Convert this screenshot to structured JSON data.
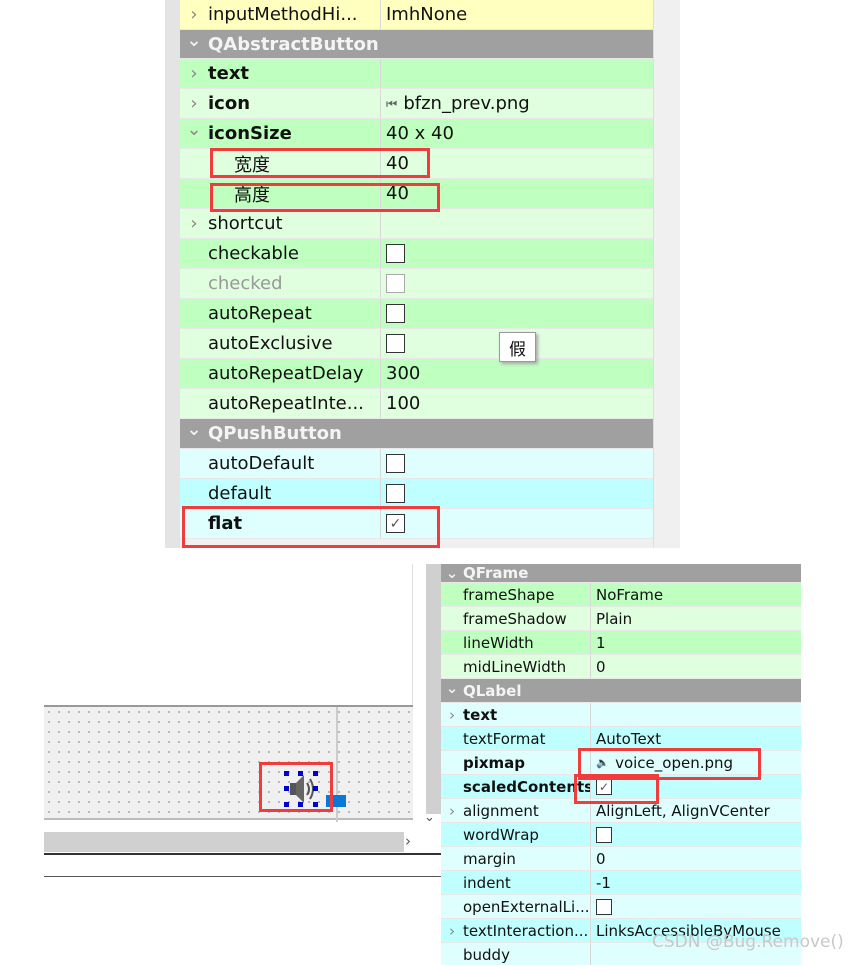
{
  "top_panel": {
    "rows": [
      {
        "label": "inputMethodHi...",
        "value": "ImhNone",
        "bg": "#ffffc0",
        "expand": "right"
      },
      {
        "label": "QAbstractButton",
        "header": true
      },
      {
        "label": "text",
        "value": "",
        "bg": "#bfffbf",
        "bold": true,
        "expand": "right"
      },
      {
        "label": "icon",
        "value": "bfzn_prev.png",
        "icon": "prev-icon",
        "bg": "#dfffdf",
        "bold": true,
        "expand": "right"
      },
      {
        "label": "iconSize",
        "value": "40 x 40",
        "bg": "#bfffbf",
        "bold": true,
        "expand": "down"
      },
      {
        "label": "宽度",
        "value": "40",
        "bg": "#dfffdf",
        "indent": true
      },
      {
        "label": "高度",
        "value": "40",
        "bg": "#bfffbf",
        "indent": true
      },
      {
        "label": "shortcut",
        "value": "",
        "bg": "#dfffdf",
        "expand": "right"
      },
      {
        "label": "checkable",
        "checkbox": false,
        "bg": "#bfffbf"
      },
      {
        "label": "checked",
        "checkbox": false,
        "disabled": true,
        "bg": "#dfffdf"
      },
      {
        "label": "autoRepeat",
        "checkbox": false,
        "bg": "#bfffbf"
      },
      {
        "label": "autoExclusive",
        "checkbox": false,
        "bg": "#dfffdf"
      },
      {
        "label": "autoRepeatDelay",
        "value": "300",
        "bg": "#bfffbf"
      },
      {
        "label": "autoRepeatInte...",
        "value": "100",
        "bg": "#dfffdf"
      },
      {
        "label": "QPushButton",
        "header": true
      },
      {
        "label": "autoDefault",
        "checkbox": false,
        "bg": "#dfffff"
      },
      {
        "label": "default",
        "checkbox": false,
        "bg": "#bfffff"
      },
      {
        "label": "flat",
        "checkbox": true,
        "bold": true,
        "bg": "#dfffff"
      }
    ],
    "tooltip": "假"
  },
  "bottom_panel": {
    "rows": [
      {
        "label": "QFrame",
        "header": true
      },
      {
        "label": "frameShape",
        "value": "NoFrame",
        "bg": "#bfffbf"
      },
      {
        "label": "frameShadow",
        "value": "Plain",
        "bg": "#dfffdf"
      },
      {
        "label": "lineWidth",
        "value": "1",
        "bg": "#bfffbf"
      },
      {
        "label": "midLineWidth",
        "value": "0",
        "bg": "#dfffdf"
      },
      {
        "label": "QLabel",
        "header": true
      },
      {
        "label": "text",
        "value": "",
        "bold": true,
        "expand": "right",
        "bg": "#dfffff"
      },
      {
        "label": "textFormat",
        "value": "AutoText",
        "bg": "#bfffff"
      },
      {
        "label": "pixmap",
        "value": "voice_open.png",
        "icon": "speaker-icon",
        "bold": true,
        "bg": "#dfffff"
      },
      {
        "label": "scaledContents",
        "checkbox": true,
        "bold": true,
        "bg": "#bfffff"
      },
      {
        "label": "alignment",
        "value": "AlignLeft, AlignVCenter",
        "expand": "right",
        "bg": "#dfffff"
      },
      {
        "label": "wordWrap",
        "checkbox": false,
        "bg": "#bfffff"
      },
      {
        "label": "margin",
        "value": "0",
        "bg": "#dfffff"
      },
      {
        "label": "indent",
        "value": "-1",
        "bg": "#bfffff"
      },
      {
        "label": "openExternalLi...",
        "checkbox": false,
        "bg": "#dfffff"
      },
      {
        "label": "textInteraction...",
        "value": "LinksAccessibleByMouse",
        "expand": "right",
        "bg": "#bfffff"
      },
      {
        "label": "buddy",
        "value": "",
        "bg": "#dfffff"
      }
    ]
  },
  "watermark": "CSDN @Bug.Remove()",
  "colors": {
    "highlight": "#f03c3c",
    "header": "#a0a0a0",
    "selection_handle": "#0000cc"
  }
}
